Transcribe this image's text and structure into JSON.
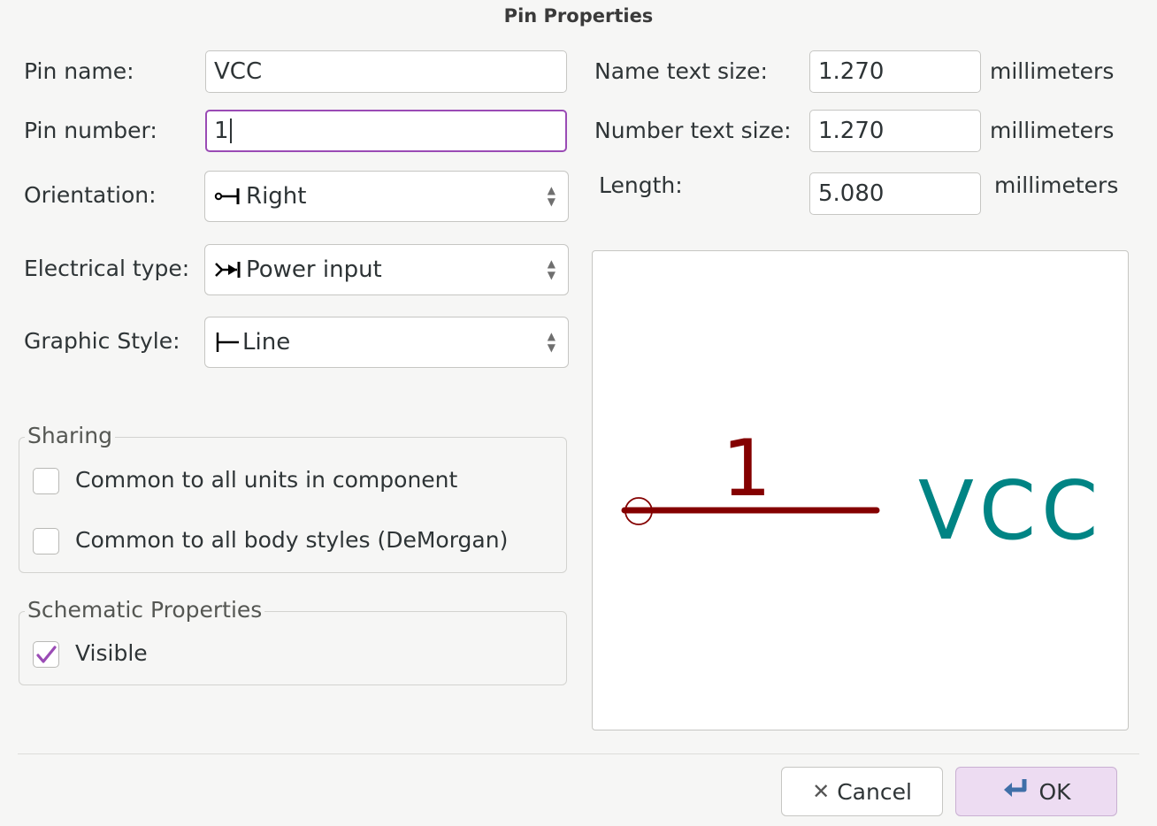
{
  "dialog": {
    "title": "Pin Properties"
  },
  "fields": {
    "pin_name_label": "Pin name:",
    "pin_name_value": "VCC",
    "pin_number_label": "Pin number:",
    "pin_number_value": "1",
    "orientation_label": "Orientation:",
    "orientation_value": "Right",
    "orientation_icon": "pin-right-icon",
    "electrical_type_label": "Electrical type:",
    "electrical_type_value": "Power input",
    "electrical_type_icon": "power-input-icon",
    "graphic_style_label": "Graphic Style:",
    "graphic_style_value": "Line",
    "graphic_style_icon": "line-style-icon",
    "name_text_size_label": "Name text size:",
    "name_text_size_value": "1.270",
    "number_text_size_label": "Number text size:",
    "number_text_size_value": "1.270",
    "length_label": "Length:",
    "length_value": "5.080",
    "unit": "millimeters"
  },
  "sharing": {
    "legend": "Sharing",
    "common_units_label": "Common to all units in component",
    "common_units_checked": false,
    "common_body_label": "Common to all body styles (DeMorgan)",
    "common_body_checked": false
  },
  "schematic": {
    "legend": "Schematic Properties",
    "visible_label": "Visible",
    "visible_checked": true
  },
  "preview": {
    "pin_number": "1",
    "pin_name": "VCC",
    "pin_color": "#840000",
    "name_color": "#008484"
  },
  "buttons": {
    "cancel_label": "Cancel",
    "cancel_icon": "close-icon",
    "ok_label": "OK",
    "ok_icon": "enter-icon"
  },
  "colors": {
    "accent": "#9a4bb5",
    "ok_bg": "#eddcf2"
  }
}
